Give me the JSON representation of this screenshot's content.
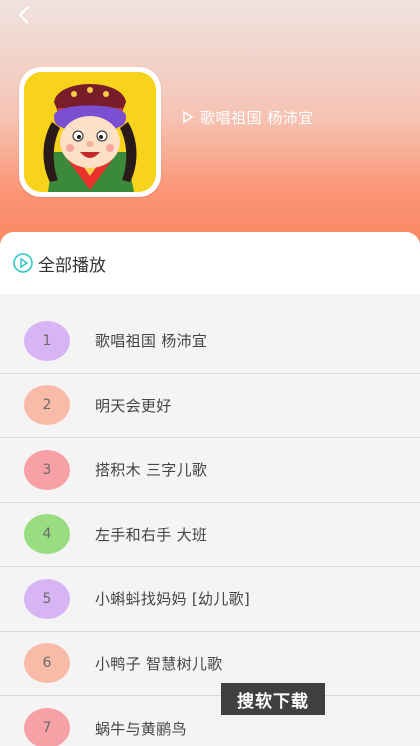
{
  "header": {
    "back_icon": "chevron-left-icon",
    "track_title": "歌唱祖国 杨沛宜",
    "play_icon": "play-outline-icon",
    "gradient_top": "#efe3e0",
    "gradient_bottom": "#fb8462"
  },
  "play_all": {
    "label": "全部播放",
    "icon": "play-circle-icon",
    "accent": "#2ec7c9"
  },
  "tracks": [
    {
      "num": "1",
      "title": "歌唱祖国 杨沛宜",
      "color": "#d7b4f3"
    },
    {
      "num": "2",
      "title": "明天会更好",
      "color": "#f7bba8"
    },
    {
      "num": "3",
      "title": "搭积木 三字儿歌",
      "color": "#f7a0a6"
    },
    {
      "num": "4",
      "title": "左手和右手 大班",
      "color": "#98dd7f"
    },
    {
      "num": "5",
      "title": "小蝌蚪找妈妈 [幼儿歌]",
      "color": "#d7b4f3"
    },
    {
      "num": "6",
      "title": "小鸭子 智慧树儿歌",
      "color": "#f7bba8"
    },
    {
      "num": "7",
      "title": "蜗牛与黄鹂鸟",
      "color": "#f7a0a6"
    }
  ],
  "watermark": "搜软下载"
}
